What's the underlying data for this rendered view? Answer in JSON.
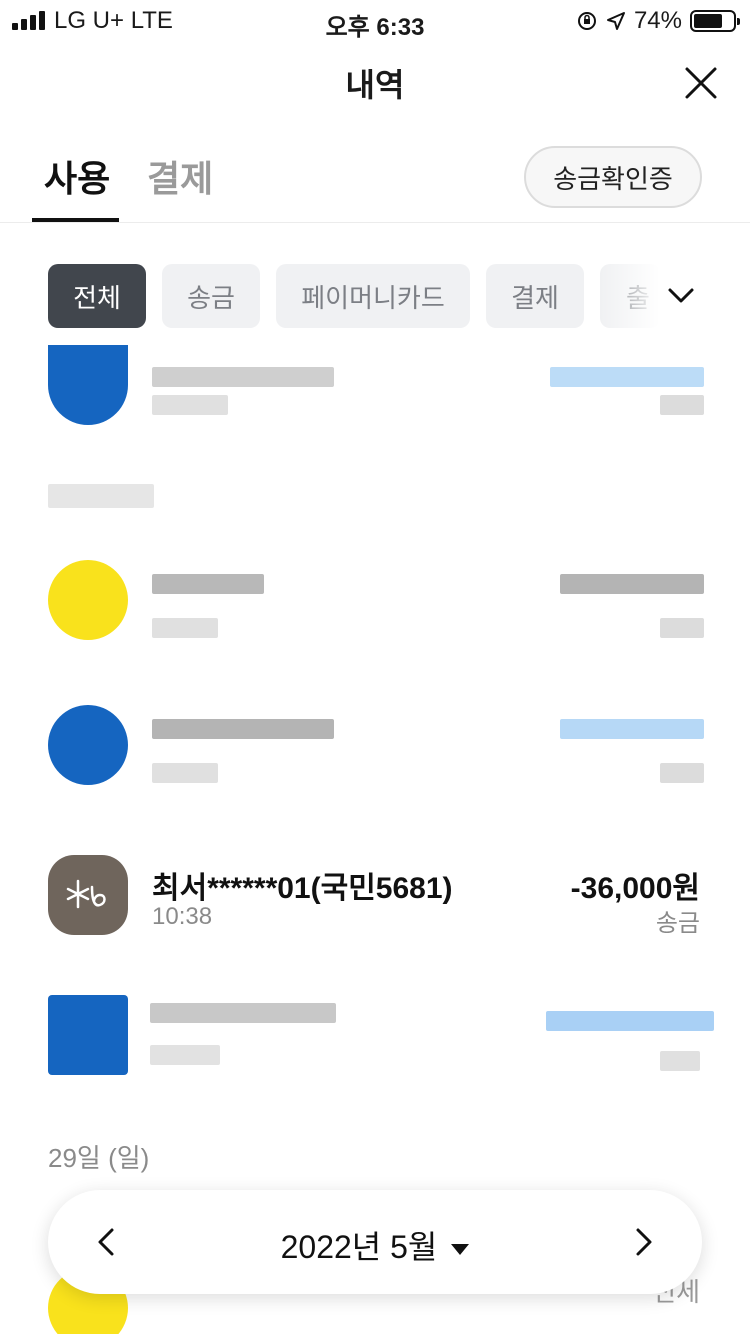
{
  "status_bar": {
    "carrier": "LG U+  LTE",
    "time": "오후 6:33",
    "battery": "74%"
  },
  "header": {
    "title": "내역"
  },
  "tabs": {
    "active": "사용",
    "inactive": "결제",
    "verify_button": "송금확인증"
  },
  "filters": [
    "전체",
    "송금",
    "페이머니카드",
    "결제",
    "출"
  ],
  "transactions": [
    {
      "name": "최서******01(국민5681)",
      "time": "10:38",
      "amount": "-36,000원",
      "type": "송금"
    }
  ],
  "date_label": "29일 (일)",
  "month_picker": {
    "label": "2022년 5월"
  },
  "partial_bottom_text": "전세",
  "colors": {
    "chip_active": "#41464d",
    "chip_inactive": "#f0f1f3",
    "blue_avatar": "#1565c0",
    "yellow_avatar": "#f9e21c",
    "kb_avatar": "#6f655c"
  }
}
